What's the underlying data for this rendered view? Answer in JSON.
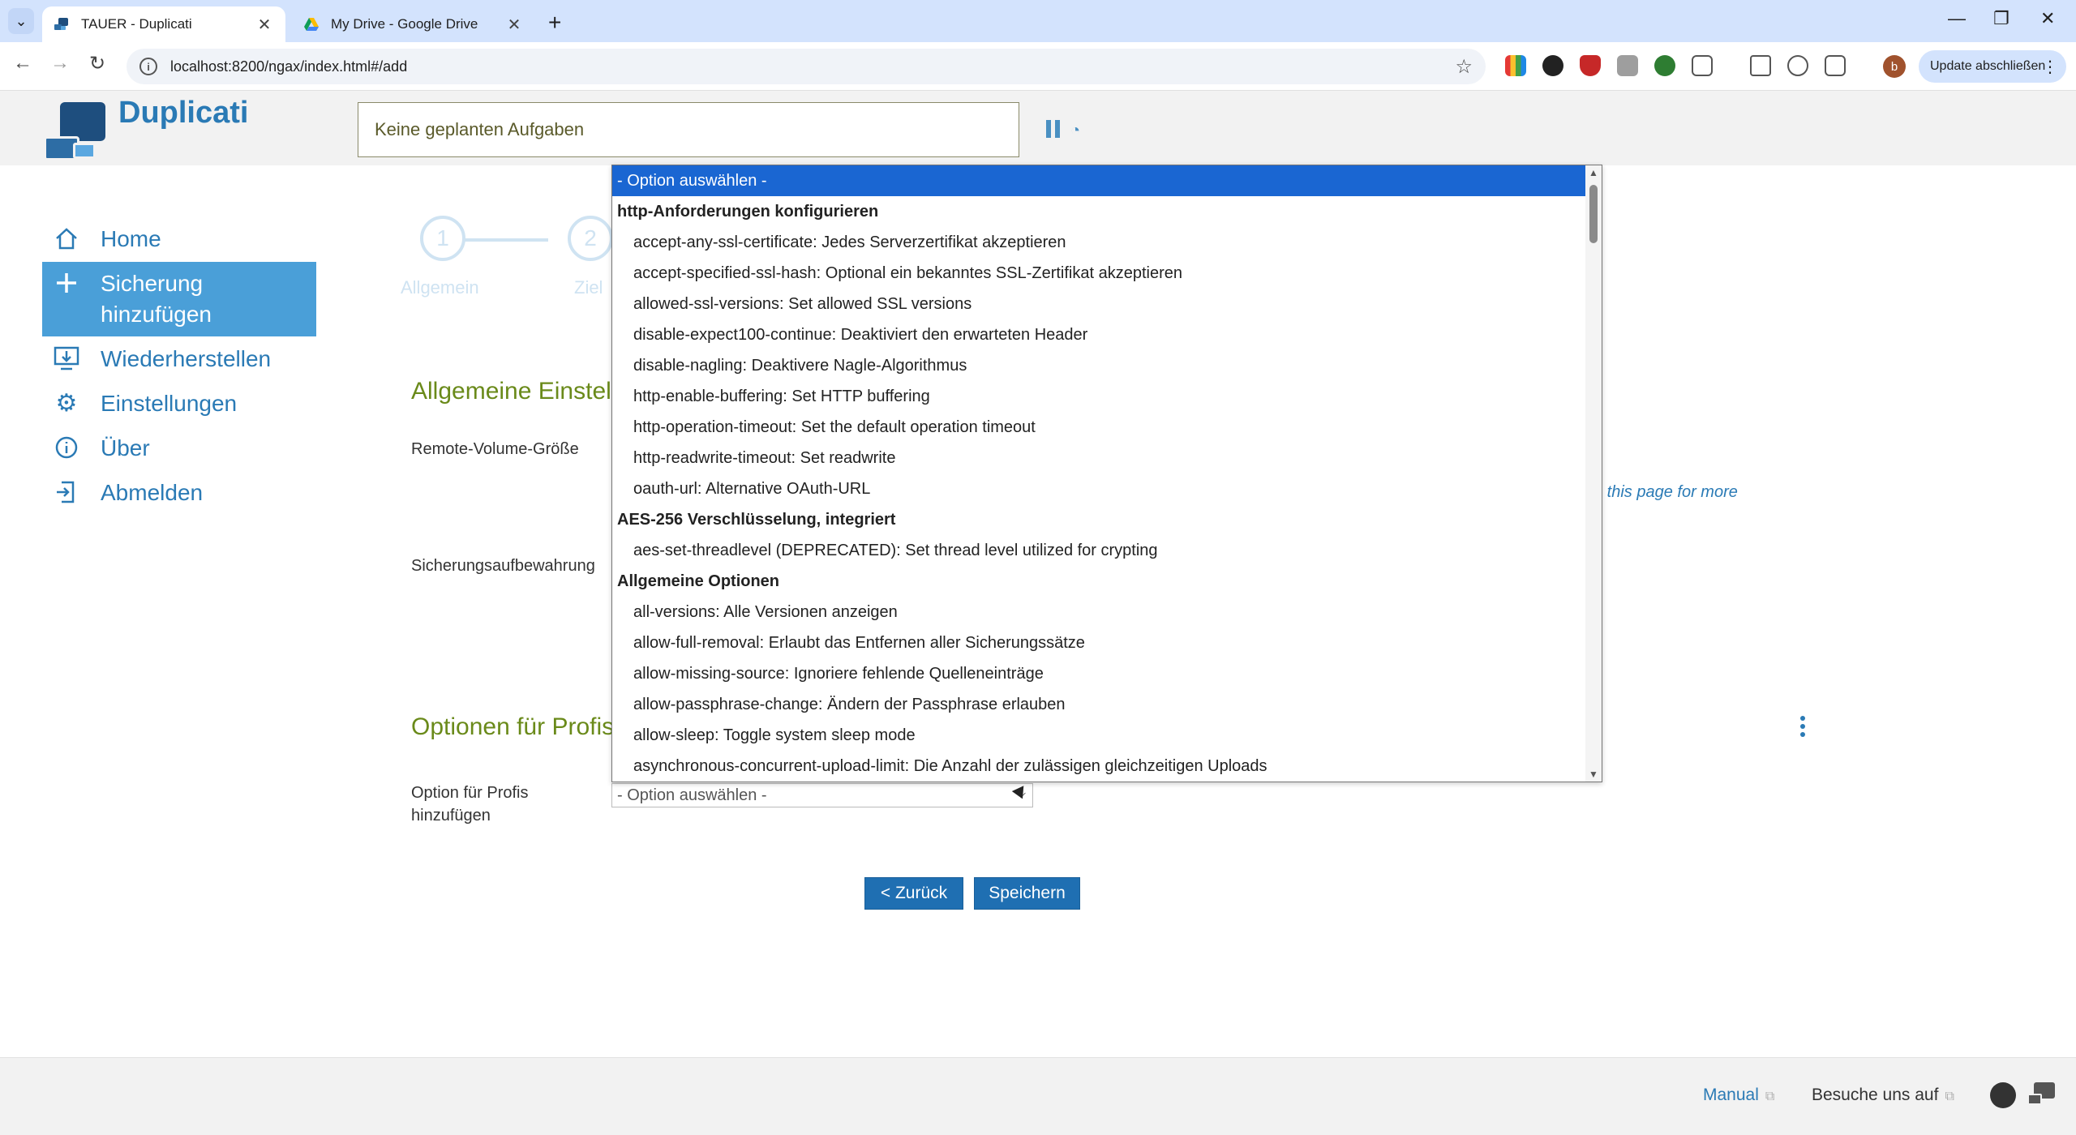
{
  "browser": {
    "tabs": [
      {
        "title": "TAUER - Duplicati",
        "active": true
      },
      {
        "title": "My Drive - Google Drive",
        "active": false
      }
    ],
    "url": "localhost:8200/ngax/index.html#/add",
    "update_label": "Update abschließen",
    "profile_initial": "b"
  },
  "header": {
    "app_name": "Duplicati",
    "status_text": "Keine geplanten Aufgaben"
  },
  "sidebar": {
    "items": [
      {
        "label": "Home",
        "icon": "home-icon",
        "active": false
      },
      {
        "label": "Sicherung hinzufügen",
        "icon": "plus-icon",
        "active": true
      },
      {
        "label": "Wiederherstellen",
        "icon": "restore-icon",
        "active": false
      },
      {
        "label": "Einstellungen",
        "icon": "gear-icon",
        "active": false
      },
      {
        "label": "Über",
        "icon": "info-icon",
        "active": false
      },
      {
        "label": "Abmelden",
        "icon": "logout-icon",
        "active": false
      }
    ]
  },
  "steps": [
    {
      "number": "1",
      "label": "Allgemein"
    },
    {
      "number": "2",
      "label": "Ziel"
    }
  ],
  "main": {
    "section_general": "Allgemeine Einstel",
    "label_remote_volume": "Remote-Volume-Größe",
    "label_retention": "Sicherungsaufbewahrung",
    "hint_text": "e this page for more",
    "section_advanced": "Optionen für Profis",
    "label_add_option": "Option für Profis hinzufügen",
    "select_value": "- Option auswählen -",
    "back_button": "< Zurück",
    "save_button": "Speichern"
  },
  "dropdown": {
    "selected": "- Option auswählen -",
    "groups": [
      {
        "label": "http-Anforderungen konfigurieren",
        "options": [
          "accept-any-ssl-certificate: Jedes Serverzertifikat akzeptieren",
          "accept-specified-ssl-hash: Optional ein bekanntes SSL-Zertifikat akzeptieren",
          "allowed-ssl-versions: Set allowed SSL versions",
          "disable-expect100-continue: Deaktiviert den erwarteten Header",
          "disable-nagling: Deaktivere Nagle-Algorithmus",
          "http-enable-buffering: Set HTTP buffering",
          "http-operation-timeout: Set the default operation timeout",
          "http-readwrite-timeout: Set readwrite",
          "oauth-url: Alternative OAuth-URL"
        ]
      },
      {
        "label": "AES-256 Verschlüsselung, integriert",
        "options": [
          "aes-set-threadlevel (DEPRECATED): Set thread level utilized for crypting"
        ]
      },
      {
        "label": "Allgemeine Optionen",
        "options": [
          "all-versions: Alle Versionen anzeigen",
          "allow-full-removal: Erlaubt das Entfernen aller Sicherungssätze",
          "allow-missing-source: Ignoriere fehlende Quelleneinträge",
          "allow-passphrase-change: Ändern der Passphrase erlauben",
          "allow-sleep: Toggle system sleep mode",
          "asynchronous-concurrent-upload-limit: Die Anzahl der zulässigen gleichzeitigen Uploads"
        ]
      }
    ]
  },
  "footer": {
    "manual": "Manual",
    "visit": "Besuche uns auf"
  },
  "colors": {
    "brand": "#2a7ab5",
    "sidebar_active": "#4a9fd8",
    "section_title": "#6a8a1a",
    "dropdown_selected": "#1a66d2",
    "button": "#1f6fb2"
  }
}
